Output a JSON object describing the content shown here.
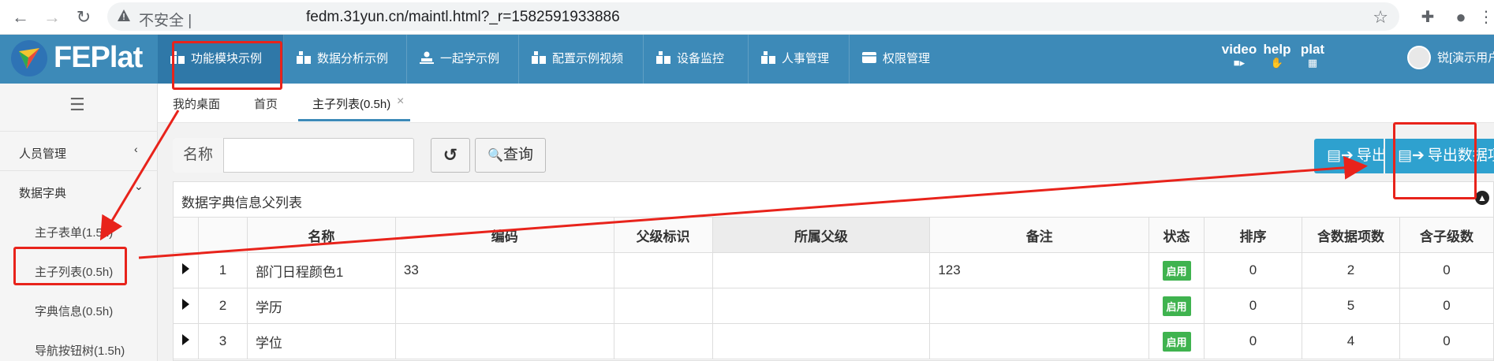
{
  "browser": {
    "insecure_label": "不安全 |",
    "url": "fedm.31yun.cn/maintl.html?_r=1582591933886"
  },
  "app": {
    "logo": "FEPlat",
    "nav": [
      "功能模块示例",
      "数据分析示例",
      "一起学示例",
      "配置示例视频",
      "设备监控",
      "人事管理",
      "权限管理"
    ],
    "header_icons": [
      "video",
      "help",
      "plat"
    ],
    "user": "锐[演示用户]"
  },
  "sidebar": {
    "groups": [
      {
        "label": "人员管理",
        "arrow": "‹"
      },
      {
        "label": "数据字典",
        "arrow": "⌄"
      }
    ],
    "items": [
      "主子表单(1.5h)",
      "主子列表(0.5h)",
      "字典信息(0.5h)",
      "导航按钮树(1.5h)"
    ]
  },
  "tabs": [
    "我的桌面",
    "首页",
    "主子列表(0.5h)"
  ],
  "tab_close": "×",
  "search": {
    "label": "名称",
    "value": "",
    "query_button": "查询"
  },
  "actions": {
    "export": "导出",
    "export_data": "导出数据项"
  },
  "panel": {
    "title": "数据字典信息父列表"
  },
  "table": {
    "headers": [
      "名称",
      "编码",
      "父级标识",
      "所属父级",
      "备注",
      "状态",
      "排序",
      "含数据项数",
      "含子级数"
    ],
    "rows": [
      {
        "index": "1",
        "name": "部门日程颜色1",
        "code": "33",
        "parent_id": "",
        "parent": "",
        "remark": "123",
        "status": "启用",
        "sort": "0",
        "items": "2",
        "children": "0"
      },
      {
        "index": "2",
        "name": "学历",
        "code": "",
        "parent_id": "",
        "parent": "",
        "remark": "",
        "status": "启用",
        "sort": "0",
        "items": "5",
        "children": "0"
      },
      {
        "index": "3",
        "name": "学位",
        "code": "",
        "parent_id": "",
        "parent": "",
        "remark": "",
        "status": "启用",
        "sort": "0",
        "items": "4",
        "children": "0"
      }
    ]
  },
  "colors": {
    "header": "#3d8ab8",
    "annotation": "#e8231b",
    "badge": "#3fb34f",
    "export_button": "#2ea1cf"
  }
}
